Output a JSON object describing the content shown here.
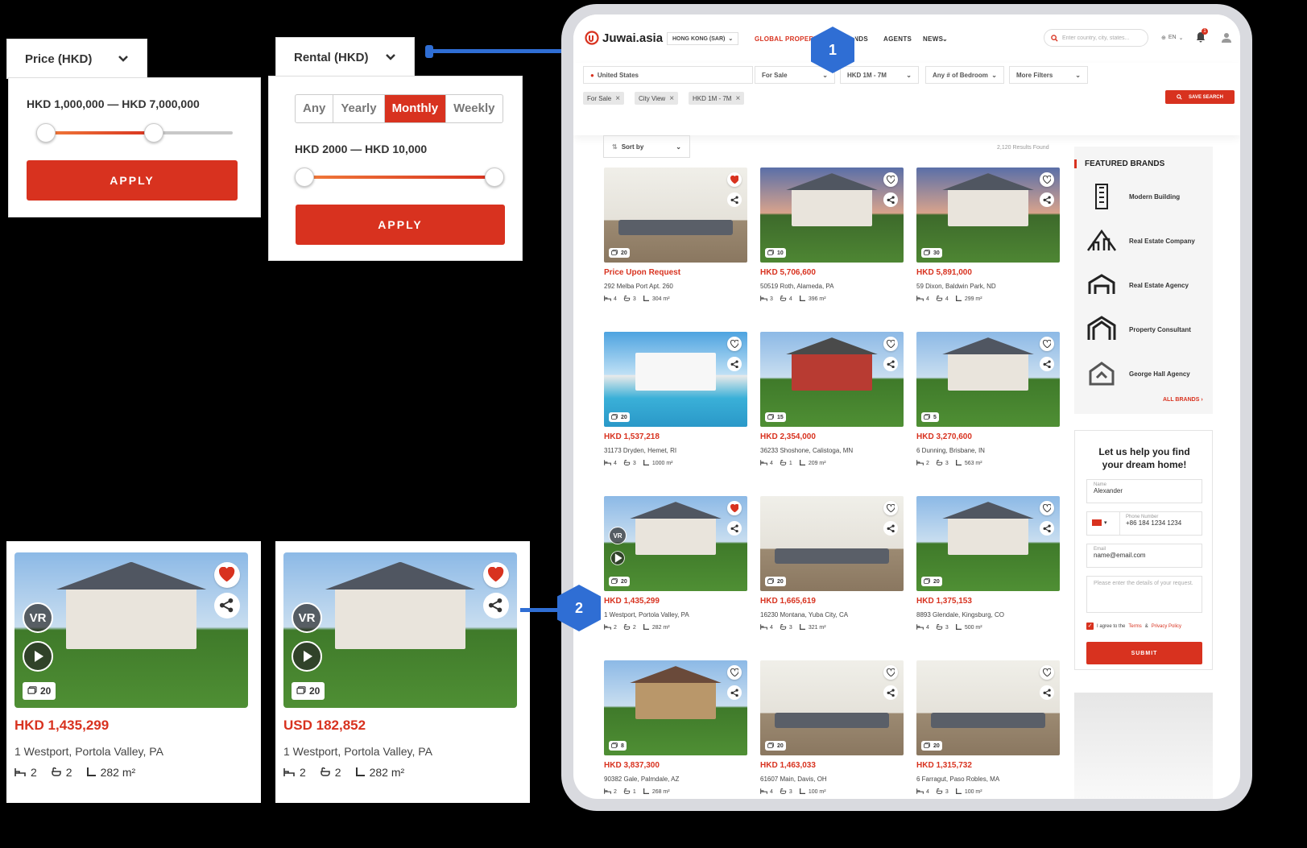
{
  "price_filter": {
    "label": "Price (HKD)",
    "range": "HKD 1,000,000 — HKD 7,000,000",
    "apply": "APPLY",
    "low_fraction": 0.05,
    "high_fraction": 0.6
  },
  "rental_filter": {
    "label": "Rental (HKD)",
    "options": [
      "Any",
      "Yearly",
      "Monthly",
      "Weekly"
    ],
    "selected": "Monthly",
    "range": "HKD 2000 — HKD 10,000",
    "apply": "APPLY",
    "low_fraction": 0.0,
    "high_fraction": 1.0
  },
  "callouts": {
    "one": "1",
    "two": "2"
  },
  "big_cards": [
    {
      "price": "HKD 1,435,299",
      "address": "1 Westport, Portola Valley, PA",
      "beds": "2",
      "baths": "2",
      "area": "282 m²",
      "photos": "20",
      "vr": "VR",
      "favorited": true
    },
    {
      "price": "USD 182,852",
      "address": "1 Westport, Portola Valley, PA",
      "beds": "2",
      "baths": "2",
      "area": "282 m²",
      "photos": "20",
      "vr": "VR",
      "favorited": true
    }
  ],
  "site": {
    "logo": "Juwai.asia",
    "region": "HONG KONG (SAR)",
    "nav": [
      "GLOBAL PROPERTIES",
      "BRANDS",
      "AGENTS",
      "NEWS"
    ],
    "search_placeholder": "Enter country, city, states...",
    "lang": "EN",
    "notifications": "1",
    "filters": {
      "location": "United States",
      "type": "For Sale",
      "price": "HKD 1M - 7M",
      "bedrooms": "Any # of Bedroom",
      "more": "More Filters"
    },
    "chips": [
      "For Sale",
      "City View",
      "HKD 1M - 7M"
    ],
    "save_search": "SAVE SEARCH",
    "sort": "Sort by",
    "results": "2,120 Results Found"
  },
  "listings": [
    {
      "price": "Price Upon Request",
      "address": "292 Melba Port Apt. 260",
      "beds": "4",
      "baths": "3",
      "area": "304 m²",
      "photos": "20",
      "fav": true,
      "style": "interior"
    },
    {
      "price": "HKD 5,706,600",
      "address": "50519 Roth, Alameda, PA",
      "beds": "3",
      "baths": "4",
      "area": "396 m²",
      "photos": "10",
      "fav": false,
      "style": "dusk"
    },
    {
      "price": "HKD 5,891,000",
      "address": "59 Dixon, Baldwin Park, ND",
      "beds": "4",
      "baths": "4",
      "area": "299 m²",
      "photos": "30",
      "fav": false,
      "style": "dusk"
    },
    {
      "price": "HKD 1,537,218",
      "address": "31173 Dryden, Hemet, RI",
      "beds": "4",
      "baths": "3",
      "area": "1000 m²",
      "photos": "20",
      "fav": false,
      "style": "pool"
    },
    {
      "price": "HKD 2,354,000",
      "address": "36233 Shoshone, Calistoga, MN",
      "beds": "4",
      "baths": "1",
      "area": "209 m²",
      "photos": "15",
      "fav": false,
      "style": "red"
    },
    {
      "price": "HKD 3,270,600",
      "address": "6 Dunning, Brisbane, IN",
      "beds": "2",
      "baths": "3",
      "area": "563 m²",
      "photos": "5",
      "fav": false,
      "style": "day"
    },
    {
      "price": "HKD 1,435,299",
      "address": "1 Westport, Portola Valley, PA",
      "beds": "2",
      "baths": "2",
      "area": "282 m²",
      "photos": "20",
      "fav": true,
      "style": "day",
      "vr": "VR"
    },
    {
      "price": "HKD 1,665,619",
      "address": "16230 Montana, Yuba City, CA",
      "beds": "4",
      "baths": "3",
      "area": "321 m²",
      "photos": "20",
      "fav": false,
      "style": "interior"
    },
    {
      "price": "HKD 1,375,153",
      "address": "8893 Glendale, Kingsburg, CO",
      "beds": "4",
      "baths": "3",
      "area": "500 m²",
      "photos": "20",
      "fav": false,
      "style": "day"
    },
    {
      "price": "HKD 3,837,300",
      "address": "90382 Gale, Palmdale, AZ",
      "beds": "2",
      "baths": "1",
      "area": "268 m²",
      "photos": "8",
      "fav": false,
      "style": "stone"
    },
    {
      "price": "HKD 1,463,033",
      "address": "61607 Main, Davis, OH",
      "beds": "4",
      "baths": "3",
      "area": "100 m²",
      "photos": "20",
      "fav": false,
      "style": "interior"
    },
    {
      "price": "HKD 1,315,732",
      "address": "6 Farragut, Paso Robles, MA",
      "beds": "4",
      "baths": "3",
      "area": "100 m²",
      "photos": "20",
      "fav": false,
      "style": "interior"
    }
  ],
  "brands": {
    "title": "FEATURED BRANDS",
    "items": [
      "Modern Building",
      "Real Estate Company",
      "Real Estate Agency",
      "Property Consultant",
      "George Hall Agency"
    ],
    "all": "ALL BRANDS ›"
  },
  "contact": {
    "title": "Let us help you find your dream home!",
    "name_label": "Name",
    "name_value": "Alexander",
    "phone_label": "Phone Number",
    "phone_value": "+86 184 1234 1234",
    "email_label": "Email",
    "email_value": "name@email.com",
    "details_placeholder": "Please enter the details of your request.",
    "agree_prefix": "I agree to the",
    "terms": "Terms",
    "and": "&",
    "privacy": "Privacy Policy",
    "submit": "SUBMIT"
  },
  "colors": {
    "accent": "#d8321f",
    "callout": "#2f6ed4"
  }
}
